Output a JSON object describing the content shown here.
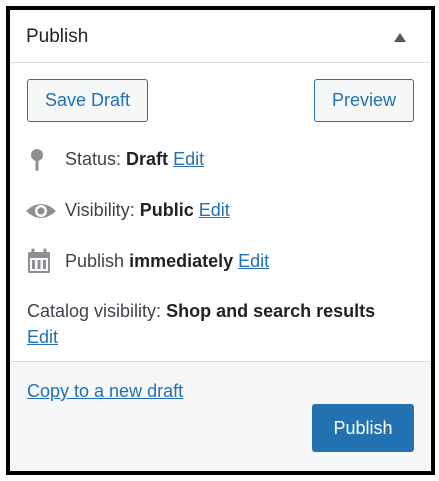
{
  "panel": {
    "title": "Publish"
  },
  "actions": {
    "save_draft": "Save Draft",
    "preview": "Preview"
  },
  "status": {
    "label": "Status:",
    "value": "Draft",
    "edit": "Edit",
    "icon": "pin-icon"
  },
  "visibility": {
    "label": "Visibility:",
    "value": "Public",
    "edit": "Edit",
    "icon": "eye-icon"
  },
  "schedule": {
    "label": "Publish",
    "value": "immediately",
    "edit": "Edit",
    "icon": "calendar-icon"
  },
  "catalog": {
    "label": "Catalog visibility:",
    "value": "Shop and search results",
    "edit": "Edit"
  },
  "footer": {
    "copy_link": "Copy to a new draft",
    "publish": "Publish"
  },
  "colors": {
    "accent": "#2271b1",
    "text": "#3c434a",
    "footer_bg": "#f6f7f7",
    "border": "#dcdcde"
  }
}
